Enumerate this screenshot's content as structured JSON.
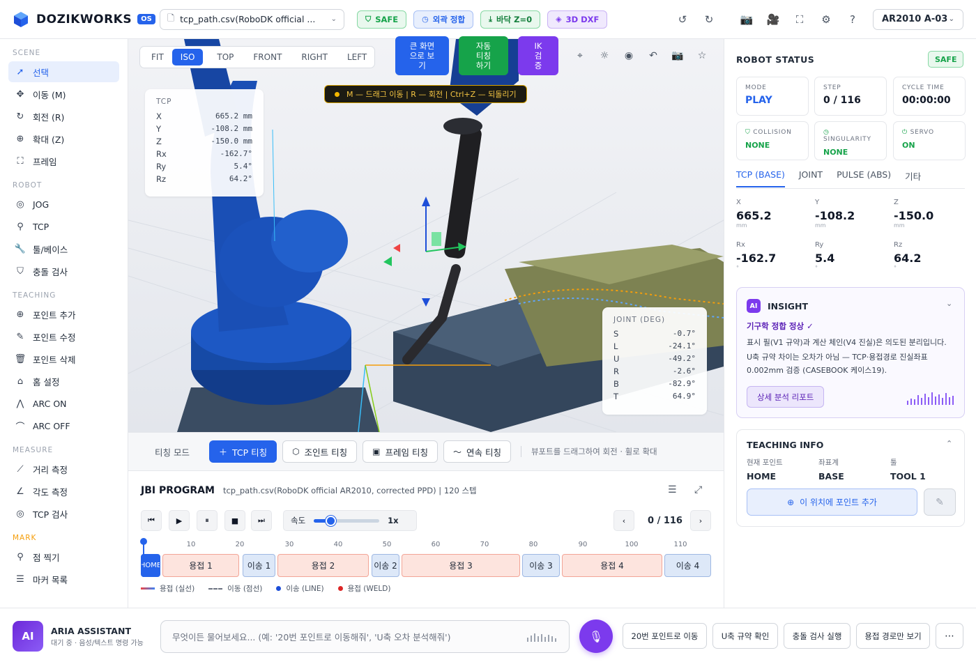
{
  "app": {
    "name": "DOZIKWORKS",
    "badge": "OS"
  },
  "topbar": {
    "file": "tcp_path.csv(RoboDK official ...",
    "chips": [
      {
        "label": "SAFE",
        "icon": "shield-icon"
      },
      {
        "label": "외곽 정합",
        "icon": "clock-icon"
      },
      {
        "label": "바닥 Z=0",
        "icon": "download-icon"
      },
      {
        "label": "3D DXF",
        "icon": "layers-icon"
      }
    ],
    "robot": "AR2010 A-03"
  },
  "sidebar": {
    "sections": [
      {
        "title": "SCENE",
        "items": [
          {
            "label": "선택",
            "icon": "cursor-icon",
            "active": true
          },
          {
            "label": "이동 (M)",
            "icon": "move-icon"
          },
          {
            "label": "회전 (R)",
            "icon": "rotate-icon"
          },
          {
            "label": "확대 (Z)",
            "icon": "zoom-icon"
          },
          {
            "label": "프레임",
            "icon": "frame-icon"
          }
        ]
      },
      {
        "title": "ROBOT",
        "items": [
          {
            "label": "JOG",
            "icon": "jog-icon"
          },
          {
            "label": "TCP",
            "icon": "tcp-icon"
          },
          {
            "label": "툴/베이스",
            "icon": "wrench-icon"
          },
          {
            "label": "충돌 검사",
            "icon": "shield-check-icon"
          }
        ]
      },
      {
        "title": "TEACHING",
        "items": [
          {
            "label": "포인트 추가",
            "icon": "plus-circle-icon"
          },
          {
            "label": "포인트 수정",
            "icon": "edit-icon"
          },
          {
            "label": "포인트 삭제",
            "icon": "trash-icon"
          },
          {
            "label": "홈 설정",
            "icon": "home-icon"
          },
          {
            "label": "ARC ON",
            "icon": "arc-on-icon"
          },
          {
            "label": "ARC OFF",
            "icon": "arc-off-icon"
          }
        ]
      },
      {
        "title": "MEASURE",
        "items": [
          {
            "label": "거리 측정",
            "icon": "ruler-icon"
          },
          {
            "label": "각도 측정",
            "icon": "angle-icon"
          },
          {
            "label": "TCP 검사",
            "icon": "target-icon"
          }
        ]
      },
      {
        "title": "MARK",
        "items": [
          {
            "label": "점 찍기",
            "icon": "pin-icon"
          },
          {
            "label": "마커 목록",
            "icon": "list-icon"
          }
        ]
      }
    ]
  },
  "viewport": {
    "views": [
      "FIT",
      "ISO",
      "TOP",
      "FRONT",
      "RIGHT",
      "LEFT"
    ],
    "active_view": "ISO",
    "big_buttons": [
      {
        "label": "큰 화면으로 보기",
        "lines": [
          "큰 화면",
          "으로 보",
          "기"
        ],
        "color": "#2563eb"
      },
      {
        "label": "자동 티칭 하기",
        "lines": [
          "자동",
          "티칭",
          "하기"
        ],
        "color": "#16a34a"
      },
      {
        "label": "IK 검증",
        "lines": [
          "IK",
          "검",
          "증"
        ],
        "color": "#7c3aed"
      }
    ],
    "hint": "M — 드래그 이동 | R — 회전 | Ctrl+Z — 되돌리기",
    "tcp": {
      "title": "TCP",
      "rows": [
        {
          "k": "X",
          "v": "665.2 mm"
        },
        {
          "k": "Y",
          "v": "-108.2 mm"
        },
        {
          "k": "Z",
          "v": "-150.0 mm"
        },
        {
          "k": "Rx",
          "v": "-162.7°"
        },
        {
          "k": "Ry",
          "v": "5.4°"
        },
        {
          "k": "Rz",
          "v": "64.2°"
        }
      ]
    },
    "joint": {
      "title": "JOINT (DEG)",
      "rows": [
        {
          "k": "S",
          "v": "-0.7°"
        },
        {
          "k": "L",
          "v": "-24.1°"
        },
        {
          "k": "U",
          "v": "-49.2°"
        },
        {
          "k": "R",
          "v": "-2.6°"
        },
        {
          "k": "B",
          "v": "-82.9°"
        },
        {
          "k": "T",
          "v": "64.9°"
        }
      ]
    }
  },
  "teach": {
    "label": "티칭 모드",
    "buttons": [
      {
        "label": "TCP 티칭",
        "icon": "plus-icon",
        "primary": true
      },
      {
        "label": "조인트 티칭",
        "icon": "hexagon-icon"
      },
      {
        "label": "프레임 티칭",
        "icon": "square-icon"
      },
      {
        "label": "연속 티칭",
        "icon": "wave-icon"
      }
    ],
    "note": "뷰포트를 드래그하여 회전 · 휠로 확대"
  },
  "jbi": {
    "title": "JBI PROGRAM",
    "subtitle": "tcp_path.csv(RoboDK official AR2010, corrected PPD) | 120 스텝",
    "speed_label": "속도",
    "speed_value": "1x",
    "speed_fraction": 0.25,
    "counter": "0 / 116",
    "ticks": [
      "10",
      "20",
      "30",
      "40",
      "50",
      "60",
      "70",
      "80",
      "90",
      "100",
      "110"
    ],
    "segments": [
      {
        "label": "HOME",
        "type": "home"
      },
      {
        "label": "용접 1",
        "type": "weld"
      },
      {
        "label": "이송 1",
        "type": "move"
      },
      {
        "label": "용접 2",
        "type": "weld"
      },
      {
        "label": "이송 2",
        "type": "move"
      },
      {
        "label": "용접 3",
        "type": "weld"
      },
      {
        "label": "이송 3",
        "type": "move"
      },
      {
        "label": "용접 4",
        "type": "weld"
      },
      {
        "label": "이송 4",
        "type": "move"
      }
    ],
    "legend": [
      "용접 (실선)",
      "이동 (점선)",
      "이송 (LINE)",
      "용접 (WELD)"
    ]
  },
  "status": {
    "title": "ROBOT STATUS",
    "safe": "SAFE",
    "cards": [
      {
        "k": "MODE",
        "v": "PLAY"
      },
      {
        "k": "STEP",
        "v": "0 / 116"
      },
      {
        "k": "CYCLE TIME",
        "v": "00:00:00"
      },
      {
        "k": "COLLISION",
        "v": "NONE"
      },
      {
        "k": "SINGULARITY",
        "v": "NONE"
      },
      {
        "k": "SERVO",
        "v": "ON"
      }
    ],
    "tabs": [
      "TCP (BASE)",
      "JOINT",
      "PULSE (ABS)",
      "기타"
    ],
    "coords": [
      {
        "k": "X",
        "v": "665.2",
        "u": "mm"
      },
      {
        "k": "Y",
        "v": "-108.2",
        "u": "mm"
      },
      {
        "k": "Z",
        "v": "-150.0",
        "u": "mm"
      },
      {
        "k": "Rx",
        "v": "-162.7",
        "u": "°"
      },
      {
        "k": "Ry",
        "v": "5.4",
        "u": "°"
      },
      {
        "k": "Rz",
        "v": "64.2",
        "u": "°"
      }
    ]
  },
  "insight": {
    "badge": "AI",
    "title": "INSIGHT",
    "status": "기구학 정합 정상 ✓",
    "p1": "표시 필(V1 규약)과 계산 체인(V4 진실)은 의도된 분리입니다.",
    "p2": "U축 규약 차이는 오차가 아님 — TCP·용접경로 진실좌표 0.002mm 검증 (CASEBOOK 케이스19).",
    "report": "상세 분석 리포트"
  },
  "teaching_info": {
    "title": "TEACHING INFO",
    "cols": [
      {
        "k": "현재 포인트",
        "v": "HOME"
      },
      {
        "k": "좌표계",
        "v": "BASE"
      },
      {
        "k": "툴",
        "v": "TOOL 1"
      }
    ],
    "add": "이 위치에 포인트 추가"
  },
  "assistant": {
    "avatar": "AI",
    "name": "ARIA ASSISTANT",
    "sub": "대기 중 · 음성/텍스트 명령 가능",
    "placeholder": "무엇이든 물어보세요... (예: '20번 포인트로 이동해줘', 'U축 오차 분석해줘')",
    "quick": [
      "20번 포인트로 이동",
      "U축 규약 확인",
      "충돌 검사 실행",
      "용접 경로만 보기"
    ],
    "more": "⋯"
  }
}
